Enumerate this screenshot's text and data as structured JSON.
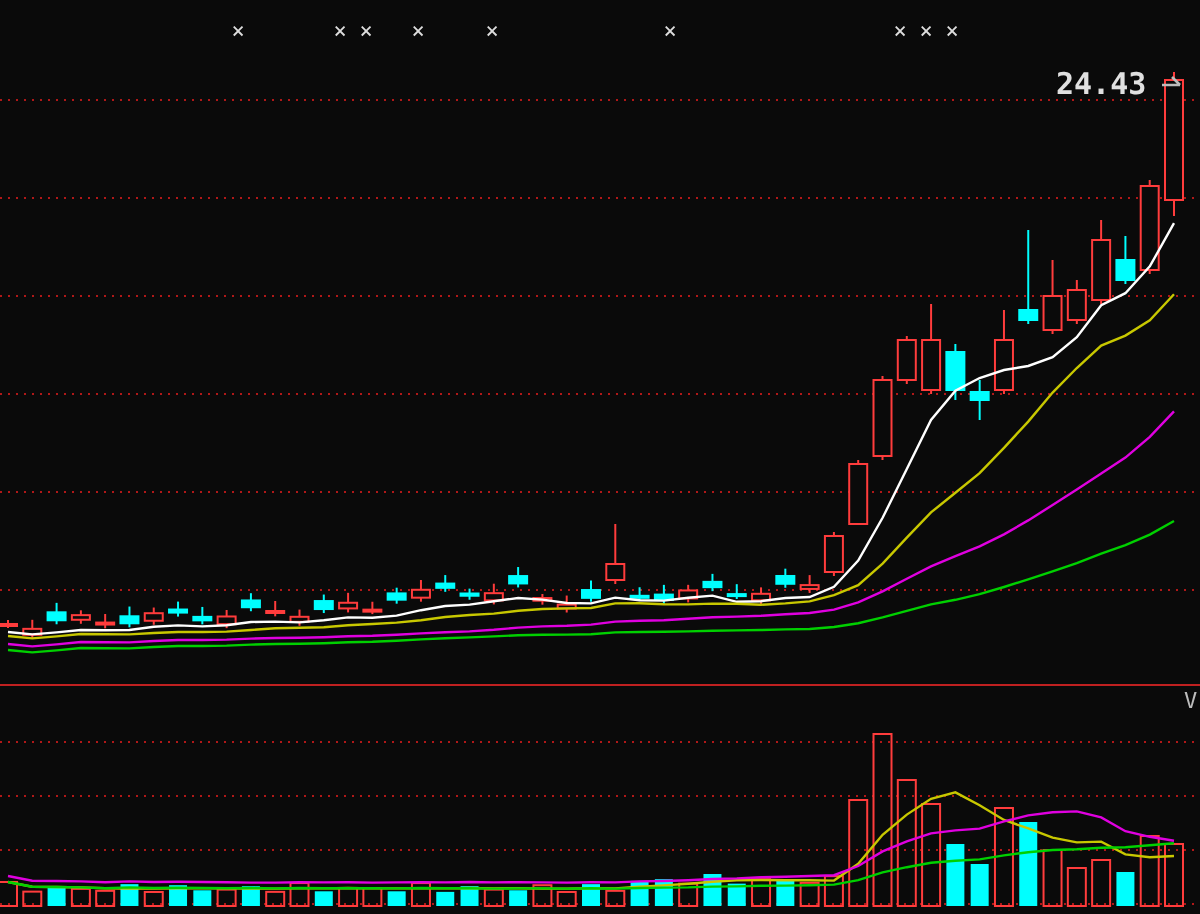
{
  "header": {
    "marks": [
      "×",
      "×",
      "×",
      "×",
      "×",
      "×",
      "×",
      "×",
      "×"
    ]
  },
  "price_chart": {
    "last_price": "24.43"
  },
  "volume_chart": {
    "label": "V"
  }
}
